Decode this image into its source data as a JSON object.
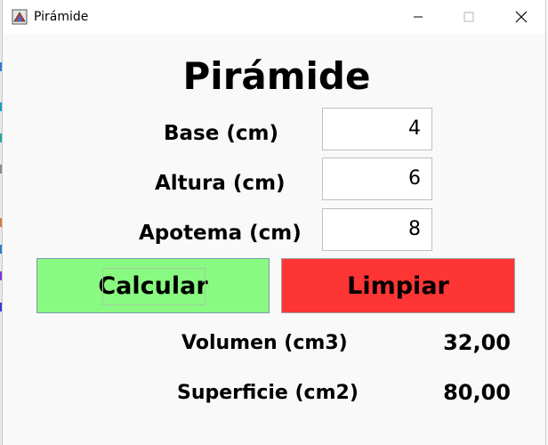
{
  "window": {
    "title": "Pirámide"
  },
  "heading": "Pirámide",
  "fields": {
    "base": {
      "label": "Base (cm)",
      "value": "4"
    },
    "altura": {
      "label": "Altura (cm)",
      "value": "6"
    },
    "apotema": {
      "label": "Apotema (cm)",
      "value": "8"
    }
  },
  "buttons": {
    "calcular": {
      "label": "Calcular",
      "color": "#89fa81"
    },
    "limpiar": {
      "label": "Limpiar",
      "color": "#fd3535"
    }
  },
  "results": {
    "volumen": {
      "label": "Volumen (cm3)",
      "value": "32,00"
    },
    "superficie": {
      "label": "Superficie (cm2)",
      "value": "80,00"
    }
  },
  "icons": {
    "app": "java-app-icon",
    "minimize": "minimize-icon",
    "maximize": "maximize-icon",
    "close": "close-icon"
  }
}
